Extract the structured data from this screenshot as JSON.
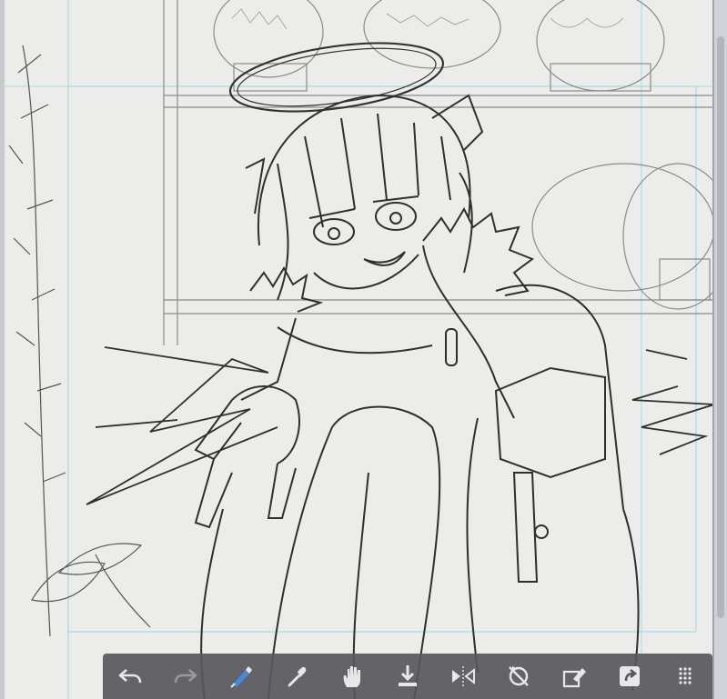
{
  "canvas": {
    "paper_color": "#ececea",
    "line_color": "#3a3a3a",
    "guide_color": "#8fd9e0"
  },
  "toolbar": {
    "background": "#58585c",
    "icon_color": "#e8e8e8",
    "active_color": "#3f8de0",
    "tools": [
      {
        "icon": "undo-icon"
      },
      {
        "icon": "redo-icon"
      },
      {
        "icon": "brush-icon",
        "active": true
      },
      {
        "icon": "eyedropper-icon"
      },
      {
        "icon": "hand-icon"
      },
      {
        "icon": "save-icon"
      },
      {
        "icon": "flip-icon"
      },
      {
        "icon": "rotate-reset-icon"
      },
      {
        "icon": "fill-icon"
      },
      {
        "icon": "share-icon"
      },
      {
        "icon": "grid-menu-icon"
      }
    ]
  }
}
